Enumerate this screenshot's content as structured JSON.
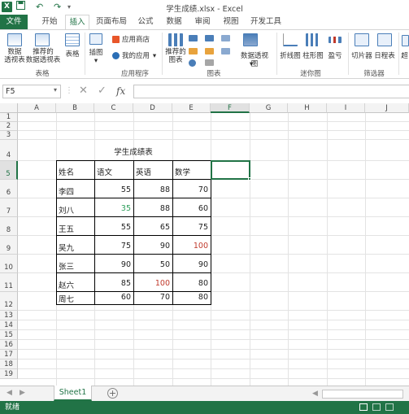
{
  "app": {
    "title": "学生成绩.xlsx - Excel",
    "logo": "X",
    "quick_access": [
      "save-icon",
      "undo-icon",
      "redo-icon"
    ]
  },
  "tabs": [
    "文件",
    "开始",
    "插入",
    "页面布局",
    "公式",
    "数据",
    "审阅",
    "视图",
    "开发工具"
  ],
  "ribbon": {
    "pivot_table": "数据\n透视表",
    "recommended_pivot": "推荐的\n数据透视表",
    "table": "表格",
    "illustrations": "插图",
    "app_store": "应用商店",
    "my_apps": "我的应用",
    "recommended_charts": "推荐的\n图表",
    "pivot_chart": "数据透视图",
    "line": "折线图",
    "column": "柱形图",
    "winloss": "盈亏",
    "slicer": "切片器",
    "timeline": "日程表",
    "hyperlink": "超",
    "groups": {
      "tables": "表格",
      "apps": "应用程序",
      "charts": "图表",
      "sparklines": "迷你图",
      "filters": "筛选器"
    }
  },
  "formula_bar": {
    "name_box": "F5",
    "fx": "fx",
    "value": ""
  },
  "columns": [
    "A",
    "B",
    "C",
    "D",
    "E",
    "F",
    "G",
    "H",
    "I",
    "J"
  ],
  "rows": [
    "1",
    "2",
    "3",
    "4",
    "5",
    "6",
    "7",
    "8",
    "9",
    "10",
    "11",
    "12",
    "13",
    "14",
    "15",
    "16",
    "17",
    "18",
    "19"
  ],
  "selected_cell": "F5",
  "sheet": {
    "table_title": "学生成绩表",
    "headers": [
      "姓名",
      "语文",
      "英语",
      "数学"
    ],
    "records": [
      {
        "name": "李四",
        "chinese": "55",
        "english": "88",
        "math": "70"
      },
      {
        "name": "刘八",
        "chinese": "35",
        "english": "88",
        "math": "60"
      },
      {
        "name": "王五",
        "chinese": "55",
        "english": "65",
        "math": "75"
      },
      {
        "name": "吴九",
        "chinese": "75",
        "english": "90",
        "math": "100"
      },
      {
        "name": "张三",
        "chinese": "90",
        "english": "50",
        "math": "90"
      },
      {
        "name": "赵六",
        "chinese": "85",
        "english": "100",
        "math": "80"
      },
      {
        "name": "周七",
        "chinese": "60",
        "english": "70",
        "math": "80"
      }
    ],
    "colors": {
      "low_score_green": "#2e9e5b",
      "high_score_red": "#c0392b"
    }
  },
  "sheet_tabs": [
    "Sheet1"
  ],
  "status": {
    "ready": "就绪"
  },
  "theme": {
    "accent": "#217346"
  }
}
